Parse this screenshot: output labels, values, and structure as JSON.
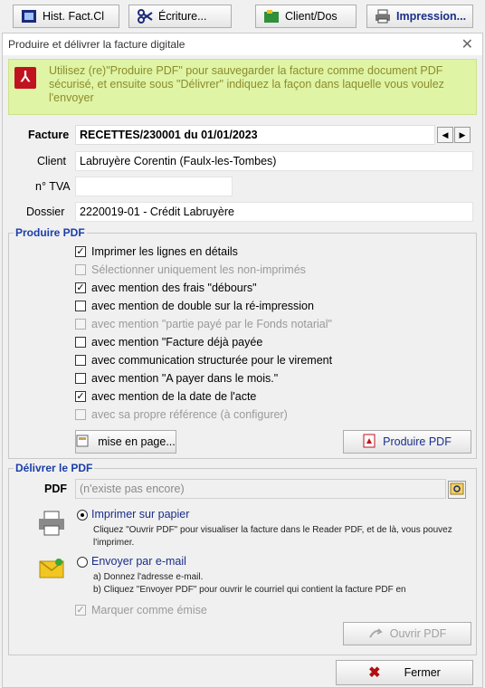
{
  "toolbar": {
    "hist_label": "Hist. Fact.Cl",
    "ecriture_label": "Écriture...",
    "client_label": "Client/Dos",
    "impression_label": "Impression..."
  },
  "dialog": {
    "title": "Produire et délivrer la facture digitale",
    "banner": "Utilisez (re)\"Produire PDF\" pour sauvegarder la facture comme document PDF sécurisé, et ensuite sous \"Délivrer\" indiquez la façon dans laquelle vous voulez l'envoyer",
    "facture_label": "Facture",
    "facture_value": "RECETTES/230001 du 01/01/2023",
    "client_label": "Client",
    "client_value": "Labruyère Corentin (Faulx-les-Tombes)",
    "tva_label": "n° TVA",
    "tva_value": "",
    "dossier_label": "Dossier",
    "dossier_value": "2220019-01 - Crédit Labruyère"
  },
  "produire": {
    "title": "Produire PDF",
    "options": [
      {
        "label": "Imprimer les lignes en détails",
        "checked": true,
        "disabled": false
      },
      {
        "label": "Sélectionner uniquement les non-imprimés",
        "checked": false,
        "disabled": true
      },
      {
        "label": "avec mention des frais \"débours\"",
        "checked": true,
        "disabled": false
      },
      {
        "label": "avec mention de double sur la ré-impression",
        "checked": false,
        "disabled": false
      },
      {
        "label": "avec mention \"partie payé par le Fonds notarial\"",
        "checked": false,
        "disabled": true
      },
      {
        "label": "avec mention \"Facture déjà payée",
        "checked": false,
        "disabled": false
      },
      {
        "label": "avec communication structurée pour le virement",
        "checked": false,
        "disabled": false
      },
      {
        "label": "avec mention \"A payer dans le mois.\"",
        "checked": false,
        "disabled": false
      },
      {
        "label": "avec mention de la date de l'acte",
        "checked": true,
        "disabled": false
      },
      {
        "label": "avec sa propre référence (à configurer)",
        "checked": false,
        "disabled": true
      }
    ],
    "mise_en_page_label": "mise en page...",
    "produire_pdf_label": "Produire PDF"
  },
  "delivrer": {
    "title": "Délivrer le PDF",
    "pdf_label": "PDF",
    "pdf_value": "(n'existe pas encore)",
    "imprimer_label": "Imprimer sur papier",
    "imprimer_desc": "Cliquez \"Ouvrir PDF\" pour visualiser la facture dans le Reader PDF, et de là, vous pouvez l'imprimer.",
    "email_label": "Envoyer par e-mail",
    "email_desc_a": "a) Donnez l'adresse e-mail.",
    "email_desc_b": "b) Cliquez \"Envoyer PDF\" pour ouvrir le courriel qui contient la facture PDF en",
    "marquer_label": "Marquer comme émise",
    "ouvrir_pdf_label": "Ouvrir PDF"
  },
  "fermer_label": "Fermer"
}
